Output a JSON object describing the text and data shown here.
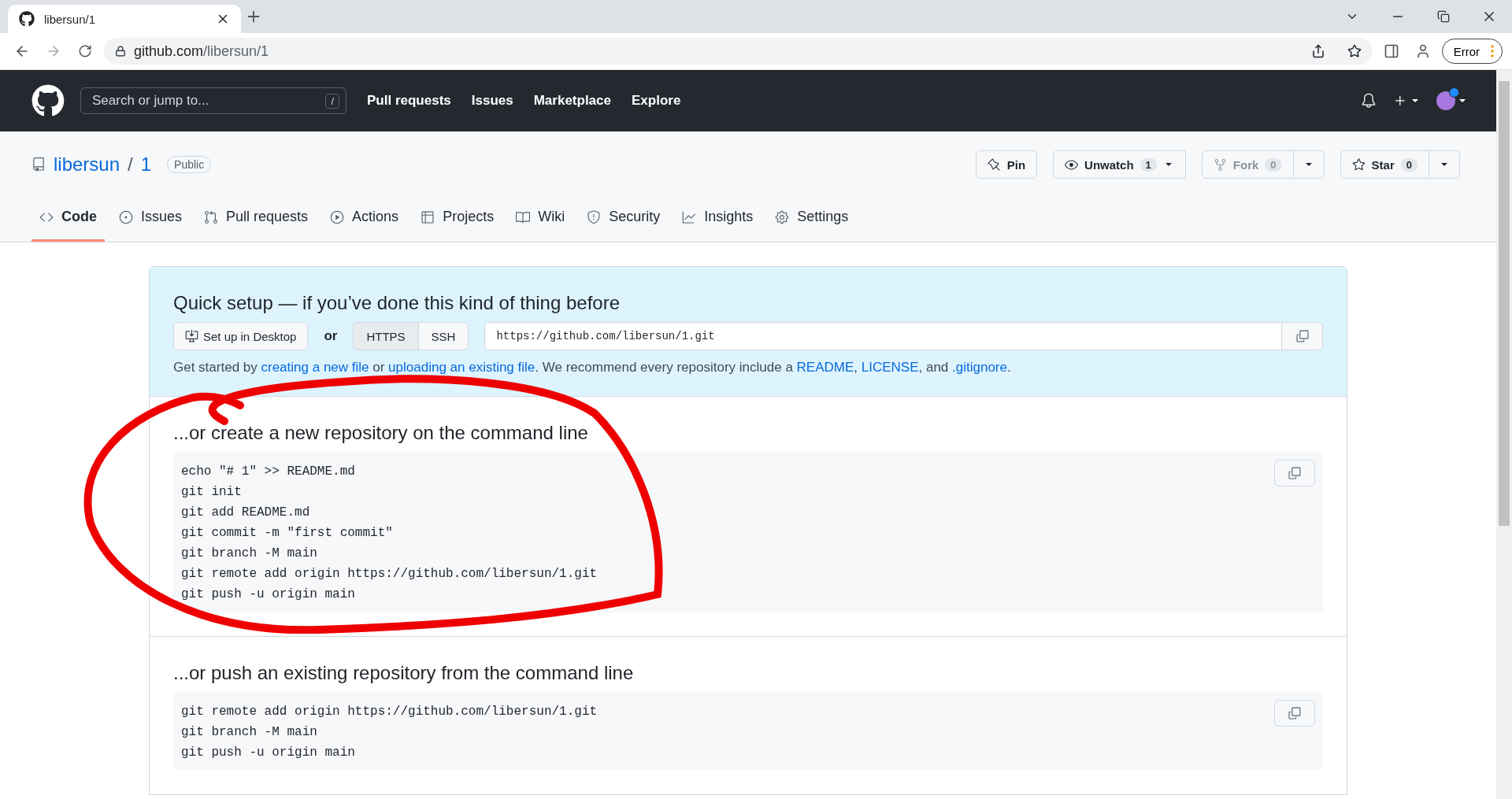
{
  "browser": {
    "tab_title": "libersun/1",
    "url_host": "github.com",
    "url_path": "/libersun/1",
    "profile_button": "Error"
  },
  "header": {
    "search_placeholder": "Search or jump to...",
    "search_key": "/",
    "nav": [
      "Pull requests",
      "Issues",
      "Marketplace",
      "Explore"
    ]
  },
  "repo": {
    "owner": "libersun",
    "separator": "/",
    "name": "1",
    "visibility": "Public",
    "actions": [
      {
        "kind": "pin",
        "label": "Pin"
      },
      {
        "kind": "watch",
        "label": "Unwatch",
        "count": "1",
        "disabled": false
      },
      {
        "kind": "fork",
        "label": "Fork",
        "count": "0",
        "disabled": true
      },
      {
        "kind": "star",
        "label": "Star",
        "count": "0",
        "disabled": false
      }
    ],
    "tabs": [
      {
        "label": "Code",
        "selected": true
      },
      {
        "label": "Issues",
        "selected": false
      },
      {
        "label": "Pull requests",
        "selected": false
      },
      {
        "label": "Actions",
        "selected": false
      },
      {
        "label": "Projects",
        "selected": false
      },
      {
        "label": "Wiki",
        "selected": false
      },
      {
        "label": "Security",
        "selected": false
      },
      {
        "label": "Insights",
        "selected": false
      },
      {
        "label": "Settings",
        "selected": false
      }
    ]
  },
  "quick_setup": {
    "title": "Quick setup — if you’ve done this kind of thing before",
    "desktop_button": "Set up in Desktop",
    "or": "or",
    "protocols": [
      {
        "label": "HTTPS",
        "selected": true
      },
      {
        "label": "SSH",
        "selected": false
      }
    ],
    "clone_url": "https://github.com/libersun/1.git",
    "help": [
      {
        "kind": "text",
        "text": "Get started by "
      },
      {
        "kind": "link",
        "text": "creating a new file"
      },
      {
        "kind": "text",
        "text": " or "
      },
      {
        "kind": "link",
        "text": "uploading an existing file"
      },
      {
        "kind": "text",
        "text": ". We recommend every repository include a "
      },
      {
        "kind": "link",
        "text": "README"
      },
      {
        "kind": "text",
        "text": ", "
      },
      {
        "kind": "link",
        "text": "LICENSE"
      },
      {
        "kind": "text",
        "text": ", and "
      },
      {
        "kind": "link",
        "text": ".gitignore"
      },
      {
        "kind": "text",
        "text": "."
      }
    ]
  },
  "sections": [
    {
      "title": "...or create a new repository on the command line",
      "lines": [
        "echo \"# 1\" >> README.md",
        "git init",
        "git add README.md",
        "git commit -m \"first commit\"",
        "git branch -M main",
        "git remote add origin https://github.com/libersun/1.git",
        "git push -u origin main"
      ]
    },
    {
      "title": "...or push an existing repository from the command line",
      "lines": [
        "git remote add origin https://github.com/libersun/1.git",
        "git branch -M main",
        "git push -u origin main"
      ]
    }
  ]
}
